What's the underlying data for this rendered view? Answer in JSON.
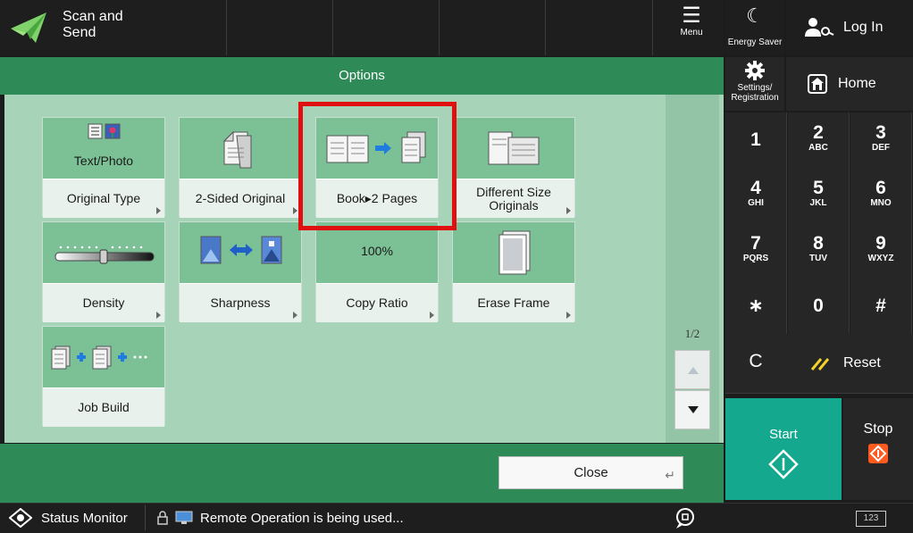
{
  "header": {
    "app_title": "Scan and\nSend",
    "menu_label": "Menu",
    "energy_saver_label": "Energy Saver",
    "login_label": "Log In"
  },
  "options": {
    "title": "Options",
    "tiles": [
      {
        "label": "Original Type",
        "value": "Text/Photo",
        "icon": "text-photo-icon"
      },
      {
        "label": "2-Sided Original",
        "icon": "two-sided-document-icon"
      },
      {
        "label": "Book▸2 Pages",
        "icon": "book-to-pages-icon"
      },
      {
        "label": "Different Size Originals",
        "icon": "different-size-originals-icon"
      },
      {
        "label": "Density",
        "icon": "density-slider-icon"
      },
      {
        "label": "Sharpness",
        "icon": "sharpness-icon"
      },
      {
        "label": "Copy Ratio",
        "value": "100%"
      },
      {
        "label": "Erase Frame",
        "icon": "erase-frame-icon"
      },
      {
        "label": "Job Build",
        "icon": "job-build-icon"
      }
    ],
    "page_indicator": "1/2",
    "close_label": "Close"
  },
  "right_panel": {
    "settings_label": "Settings/\nRegistration",
    "home_label": "Home",
    "keypad": [
      {
        "digit": "1",
        "letters": ""
      },
      {
        "digit": "2",
        "letters": "ABC"
      },
      {
        "digit": "3",
        "letters": "DEF"
      },
      {
        "digit": "4",
        "letters": "GHI"
      },
      {
        "digit": "5",
        "letters": "JKL"
      },
      {
        "digit": "6",
        "letters": "MNO"
      },
      {
        "digit": "7",
        "letters": "PQRS"
      },
      {
        "digit": "8",
        "letters": "TUV"
      },
      {
        "digit": "9",
        "letters": "WXYZ"
      },
      {
        "digit": "∗",
        "letters": ""
      },
      {
        "digit": "0",
        "letters": ""
      },
      {
        "digit": "#",
        "letters": ""
      }
    ],
    "clear_label": "C",
    "reset_label": "Reset",
    "start_label": "Start",
    "stop_label": "Stop"
  },
  "status_bar": {
    "status_monitor_label": "Status Monitor",
    "message": "Remote Operation is being used...",
    "keyboard_label": "123"
  },
  "colors": {
    "green_header": "#2e8b57",
    "tile_top": "#7cc096",
    "highlight": "#e01010",
    "start": "#14a88e",
    "stop_icon": "#ff5a1f"
  }
}
